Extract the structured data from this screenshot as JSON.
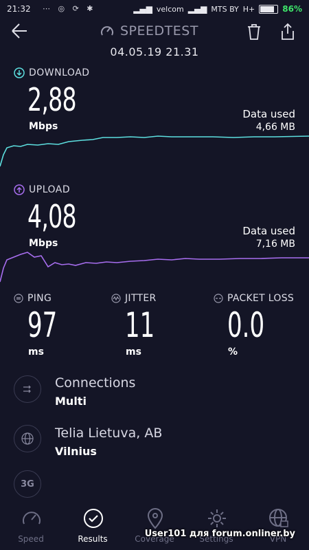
{
  "status_bar": {
    "time": "21:32",
    "carrier1": "velcom",
    "carrier2": "MTS BY",
    "network": "H+",
    "battery_pct": "86%",
    "battery_color": "#3ee36a"
  },
  "header": {
    "title": "SPEEDTEST",
    "date": "04.05.19 21.31"
  },
  "download": {
    "label": "DOWNLOAD",
    "value": "2,88",
    "unit": "Mbps",
    "data_used_label": "Data used",
    "data_used_value": "4,66 MB",
    "color": "#5de0e0"
  },
  "upload": {
    "label": "UPLOAD",
    "value": "4,08",
    "unit": "Mbps",
    "data_used_label": "Data used",
    "data_used_value": "7,16 MB",
    "color": "#a86ef0"
  },
  "stats": {
    "ping": {
      "label": "PING",
      "value": "97",
      "unit": "ms"
    },
    "jitter": {
      "label": "JITTER",
      "value": "11",
      "unit": "ms"
    },
    "packet_loss": {
      "label": "PACKET LOSS",
      "value": "0.0",
      "unit": "%"
    }
  },
  "info": {
    "connections": {
      "title": "Connections",
      "value": "Multi"
    },
    "provider": {
      "title": "Telia Lietuva, AB",
      "value": "Vilnius"
    },
    "network_badge": "3G"
  },
  "nav": {
    "items": [
      {
        "label": "Speed",
        "icon": "gauge-icon"
      },
      {
        "label": "Results",
        "icon": "check-circle-icon"
      },
      {
        "label": "Coverage",
        "icon": "map-pin-icon"
      },
      {
        "label": "Settings",
        "icon": "gear-icon"
      },
      {
        "label": "VPN",
        "icon": "globe-lock-icon"
      }
    ],
    "active": "Results"
  },
  "watermark": "User101 для forum.onliner.by"
}
